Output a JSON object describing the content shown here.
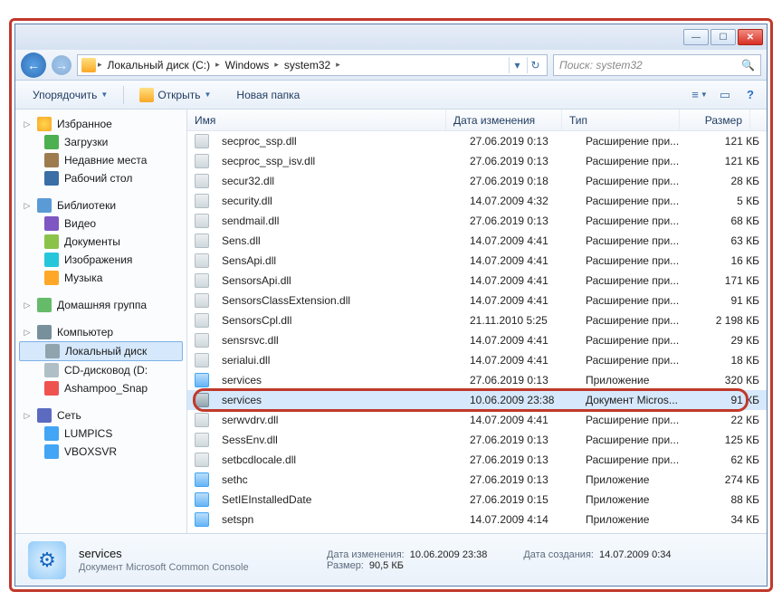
{
  "titlebar": {
    "min": "—",
    "max": "☐",
    "close": "✕"
  },
  "nav": {
    "back": "←",
    "fwd": "→",
    "crumbs": [
      "Локальный диск (С:)",
      "Windows",
      "system32"
    ],
    "sep": "▸",
    "refresh": "↻",
    "dropdown": "▾"
  },
  "search": {
    "placeholder": "Поиск: system32",
    "icon": "🔍"
  },
  "toolbar": {
    "organize": "Упорядочить",
    "open": "Открыть",
    "newfolder": "Новая папка",
    "view": "≡",
    "help": "?"
  },
  "sidebar": {
    "groups": [
      {
        "head": "Избранное",
        "ico": "sb-star",
        "items": [
          {
            "label": "Загрузки",
            "ico": "sb-dl"
          },
          {
            "label": "Недавние места",
            "ico": "sb-recent"
          },
          {
            "label": "Рабочий стол",
            "ico": "sb-desk"
          }
        ]
      },
      {
        "head": "Библиотеки",
        "ico": "sb-lib",
        "items": [
          {
            "label": "Видео",
            "ico": "sb-vid"
          },
          {
            "label": "Документы",
            "ico": "sb-doc"
          },
          {
            "label": "Изображения",
            "ico": "sb-img"
          },
          {
            "label": "Музыка",
            "ico": "sb-mus"
          }
        ]
      },
      {
        "head": "Домашняя группа",
        "ico": "sb-home",
        "items": []
      },
      {
        "head": "Компьютер",
        "ico": "sb-comp",
        "items": [
          {
            "label": "Локальный диск",
            "ico": "sb-disk",
            "sel": true
          },
          {
            "label": "CD-дисковод (D:",
            "ico": "sb-cd"
          },
          {
            "label": "Ashampoo_Snap",
            "ico": "sb-app"
          }
        ]
      },
      {
        "head": "Сеть",
        "ico": "sb-net",
        "items": [
          {
            "label": "LUMPICS",
            "ico": "sb-host"
          },
          {
            "label": "VBOXSVR",
            "ico": "sb-host"
          }
        ]
      }
    ]
  },
  "columns": {
    "name": "Имя",
    "date": "Дата изменения",
    "type": "Тип",
    "size": "Размер"
  },
  "files": [
    {
      "name": "secproc_ssp.dll",
      "date": "27.06.2019 0:13",
      "type": "Расширение при...",
      "size": "121 КБ",
      "ico": "fi-dll"
    },
    {
      "name": "secproc_ssp_isv.dll",
      "date": "27.06.2019 0:13",
      "type": "Расширение при...",
      "size": "121 КБ",
      "ico": "fi-dll"
    },
    {
      "name": "secur32.dll",
      "date": "27.06.2019 0:18",
      "type": "Расширение при...",
      "size": "28 КБ",
      "ico": "fi-dll"
    },
    {
      "name": "security.dll",
      "date": "14.07.2009 4:32",
      "type": "Расширение при...",
      "size": "5 КБ",
      "ico": "fi-dll"
    },
    {
      "name": "sendmail.dll",
      "date": "27.06.2019 0:13",
      "type": "Расширение при...",
      "size": "68 КБ",
      "ico": "fi-dll"
    },
    {
      "name": "Sens.dll",
      "date": "14.07.2009 4:41",
      "type": "Расширение при...",
      "size": "63 КБ",
      "ico": "fi-dll"
    },
    {
      "name": "SensApi.dll",
      "date": "14.07.2009 4:41",
      "type": "Расширение при...",
      "size": "16 КБ",
      "ico": "fi-dll"
    },
    {
      "name": "SensorsApi.dll",
      "date": "14.07.2009 4:41",
      "type": "Расширение при...",
      "size": "171 КБ",
      "ico": "fi-dll"
    },
    {
      "name": "SensorsClassExtension.dll",
      "date": "14.07.2009 4:41",
      "type": "Расширение при...",
      "size": "91 КБ",
      "ico": "fi-dll"
    },
    {
      "name": "SensorsCpl.dll",
      "date": "21.11.2010 5:25",
      "type": "Расширение при...",
      "size": "2 198 КБ",
      "ico": "fi-dll"
    },
    {
      "name": "sensrsvc.dll",
      "date": "14.07.2009 4:41",
      "type": "Расширение при...",
      "size": "29 КБ",
      "ico": "fi-dll"
    },
    {
      "name": "serialui.dll",
      "date": "14.07.2009 4:41",
      "type": "Расширение при...",
      "size": "18 КБ",
      "ico": "fi-dll"
    },
    {
      "name": "services",
      "date": "27.06.2019 0:13",
      "type": "Приложение",
      "size": "320 КБ",
      "ico": "fi-exe"
    },
    {
      "name": "services",
      "date": "10.06.2009 23:38",
      "type": "Документ Micros...",
      "size": "91 КБ",
      "ico": "fi-msc",
      "sel": true,
      "highlight": true
    },
    {
      "name": "serwvdrv.dll",
      "date": "14.07.2009 4:41",
      "type": "Расширение при...",
      "size": "22 КБ",
      "ico": "fi-dll"
    },
    {
      "name": "SessEnv.dll",
      "date": "27.06.2019 0:13",
      "type": "Расширение при...",
      "size": "125 КБ",
      "ico": "fi-dll"
    },
    {
      "name": "setbcdlocale.dll",
      "date": "27.06.2019 0:13",
      "type": "Расширение при...",
      "size": "62 КБ",
      "ico": "fi-dll"
    },
    {
      "name": "sethc",
      "date": "27.06.2019 0:13",
      "type": "Приложение",
      "size": "274 КБ",
      "ico": "fi-exe"
    },
    {
      "name": "SetIEInstalledDate",
      "date": "27.06.2019 0:15",
      "type": "Приложение",
      "size": "88 КБ",
      "ico": "fi-exe"
    },
    {
      "name": "setspn",
      "date": "14.07.2009 4:14",
      "type": "Приложение",
      "size": "34 КБ",
      "ico": "fi-exe"
    }
  ],
  "details": {
    "name": "services",
    "sub": "Документ Microsoft Common Console",
    "modified_label": "Дата изменения:",
    "modified": "10.06.2009 23:38",
    "size_label": "Размер:",
    "size": "90,5 КБ",
    "created_label": "Дата создания:",
    "created": "14.07.2009 0:34",
    "gear": "⚙"
  }
}
